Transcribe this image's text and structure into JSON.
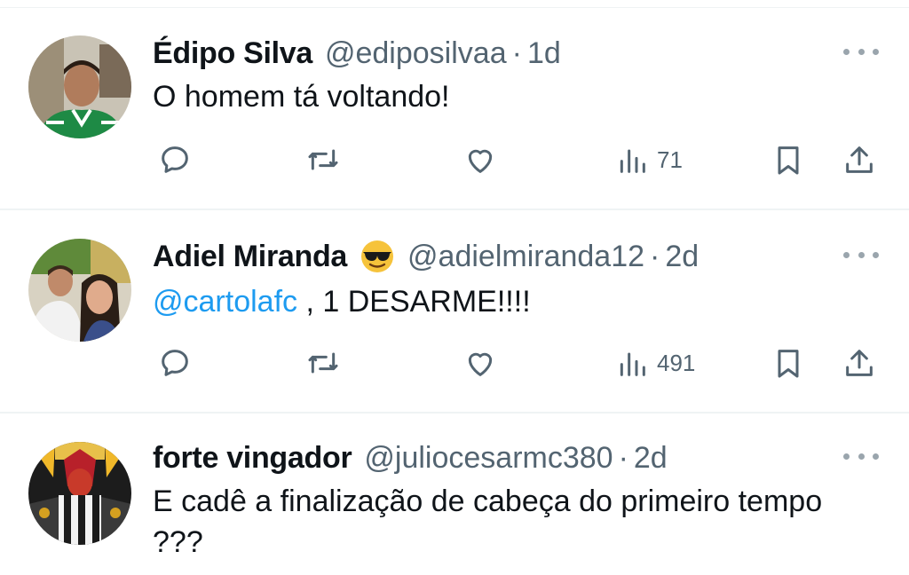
{
  "tweets": [
    {
      "name": "Édipo Silva",
      "handle": "@ediposilvaa",
      "separator": "·",
      "time": "1d",
      "text": "O homem tá voltando!",
      "views": "71",
      "avatar_desc": "man-in-green-jersey",
      "has_emoji": false
    },
    {
      "name": "Adiel Miranda",
      "emoji": "sunglasses-emoji",
      "handle": "@adielmiranda12",
      "separator": "·",
      "time": "2d",
      "mention": "@cartolafc",
      "text": " , 1 DESARME!!!!",
      "views": "491",
      "has_emoji": true
    },
    {
      "name": "forte vingador",
      "handle": "@juliocesarmc380",
      "separator": "·",
      "time": "2d",
      "text": "E cadê a finalização de cabeça do primeiro tempo ???"
    }
  ],
  "colors": {
    "text_primary": "#0f1419",
    "text_secondary": "#536471",
    "link": "#1d9bf0",
    "divider": "#eff3f4"
  },
  "icons": [
    "reply-icon",
    "retweet-icon",
    "like-icon",
    "views-icon",
    "bookmark-icon",
    "share-icon",
    "more-icon"
  ]
}
